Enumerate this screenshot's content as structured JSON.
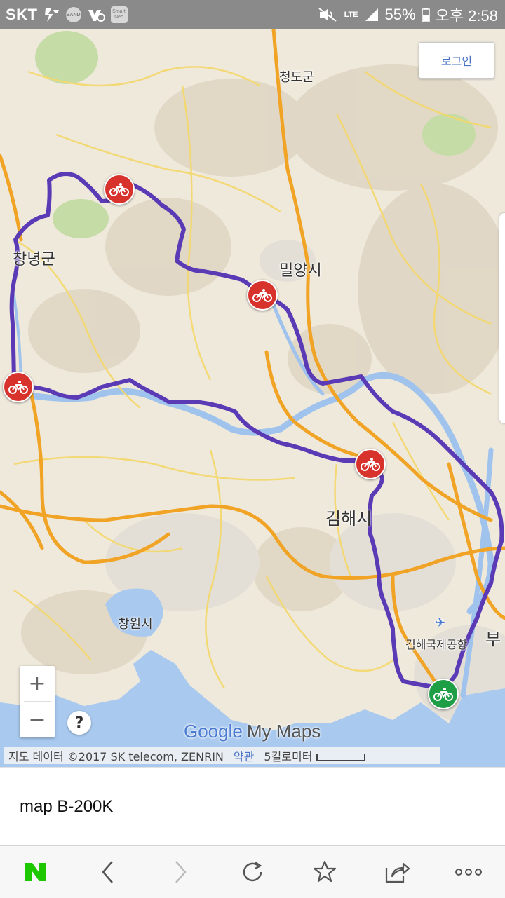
{
  "status_bar": {
    "carrier": "SKT",
    "icons": [
      "volte-icon",
      "band-icon",
      "wifi-calling-icon",
      "smartneo-icon",
      "mute-icon",
      "signal-icon",
      "battery-icon"
    ],
    "band_label": "BAND",
    "smart_label": "Smart Neo",
    "network": "LTE",
    "battery": "55%",
    "time": "오후 2:58"
  },
  "map": {
    "login_button": "로그인",
    "places": {
      "cheongdo": "청도군",
      "changnyeong": "창녕군",
      "miryang": "밀양시",
      "gimhae": "김해시",
      "changwon": "창원시",
      "airport": "김해국제공항",
      "busan_partial": "부"
    },
    "zoom_in": "+",
    "zoom_out": "−",
    "help": "?",
    "logo_google": "Google",
    "logo_mymaps": "My Maps",
    "attribution": "지도 데이터 ©2017 SK telecom, ZENRIN",
    "terms": "약관",
    "scale": "5킬로미터",
    "route_color": "#5b3bb5",
    "marker_color": "#d7322c",
    "start_marker_color": "#1e9e45"
  },
  "caption": {
    "title": "map B-200K"
  },
  "toolbar": {
    "items": [
      "naver-home-icon",
      "back-icon",
      "forward-icon",
      "reload-icon",
      "bookmark-icon",
      "share-icon",
      "more-icon"
    ],
    "naver_color": "#1ec800"
  }
}
